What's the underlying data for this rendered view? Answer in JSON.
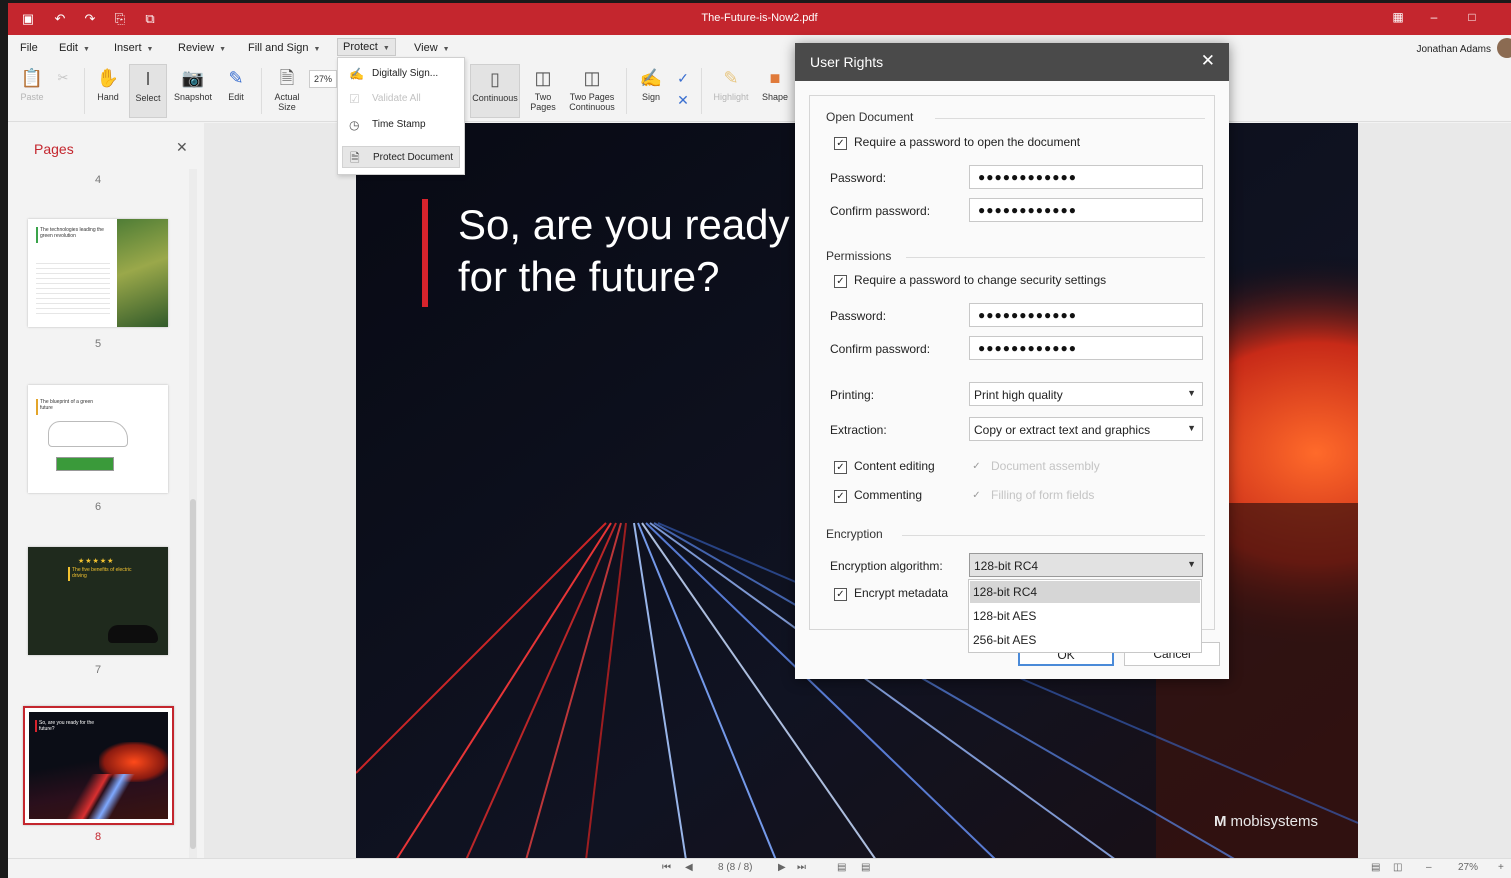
{
  "window": {
    "title": "The-Future-is-Now2.pdf",
    "user": "Jonathan Adams"
  },
  "menubar": {
    "items": [
      "File",
      "Edit",
      "Insert",
      "Review",
      "Fill and Sign",
      "Protect",
      "View"
    ]
  },
  "ribbon": {
    "paste": "Paste",
    "hand": "Hand",
    "select": "Select",
    "snapshot": "Snapshot",
    "edit": "Edit",
    "actual_size": "Actual Size",
    "zoom": "27%",
    "continuous": "Continuous",
    "two_pages": "Two Pages",
    "two_pages_continuous": "Two Pages Continuous",
    "sign": "Sign",
    "highlight": "Highlight",
    "shape": "Shape"
  },
  "protect_menu": {
    "items": [
      {
        "label": "Digitally Sign...",
        "icon": "digital-sign-icon",
        "enabled": true
      },
      {
        "label": "Validate All",
        "icon": "validate-icon",
        "enabled": false
      },
      {
        "label": "Time Stamp",
        "icon": "timestamp-icon",
        "enabled": true
      },
      {
        "label": "Protect Document",
        "icon": "protect-doc-icon",
        "enabled": true
      }
    ]
  },
  "pages_panel": {
    "title": "Pages",
    "page_numbers": [
      "4",
      "5",
      "6",
      "7",
      "8"
    ],
    "selected": "8",
    "thumb5_text": "The technologies leading the green revolution",
    "thumb6_text": "The blueprint of a green future",
    "thumb7_text": "The five benefits of electric driving",
    "thumb8_text": "So, are you ready for the future?"
  },
  "slide": {
    "line1": "So, are you ready",
    "line2": "for the future?",
    "brand": "mobisystems"
  },
  "statusbar": {
    "page_info": "8 (8 / 8)",
    "zoom": "27%"
  },
  "dialog": {
    "title": "User Rights",
    "open_document": {
      "section": "Open Document",
      "require_label": "Require a password to open the document",
      "require_checked": true,
      "password_label": "Password:",
      "password_value": "●●●●●●●●●●●●",
      "confirm_label": "Confirm password:",
      "confirm_value": "●●●●●●●●●●●●"
    },
    "permissions": {
      "section": "Permissions",
      "require_label": "Require a password to change security settings",
      "require_checked": true,
      "password_label": "Password:",
      "password_value": "●●●●●●●●●●●●",
      "confirm_label": "Confirm password:",
      "confirm_value": "●●●●●●●●●●●●",
      "printing_label": "Printing:",
      "printing_value": "Print high quality",
      "extraction_label": "Extraction:",
      "extraction_value": "Copy or extract text and graphics",
      "content_editing": "Content editing",
      "document_assembly": "Document assembly",
      "commenting": "Commenting",
      "filling_form_fields": "Filling of form fields"
    },
    "encryption": {
      "section": "Encryption",
      "algorithm_label": "Encryption algorithm:",
      "algorithm_value": "128-bit RC4",
      "metadata_label": "Encrypt metadata",
      "options": [
        "128-bit RC4",
        "128-bit AES",
        "256-bit AES"
      ]
    },
    "ok": "OK",
    "cancel": "Cancel"
  },
  "colors": {
    "accent": "#c4262e",
    "dialog_header": "#4a4a4a"
  }
}
